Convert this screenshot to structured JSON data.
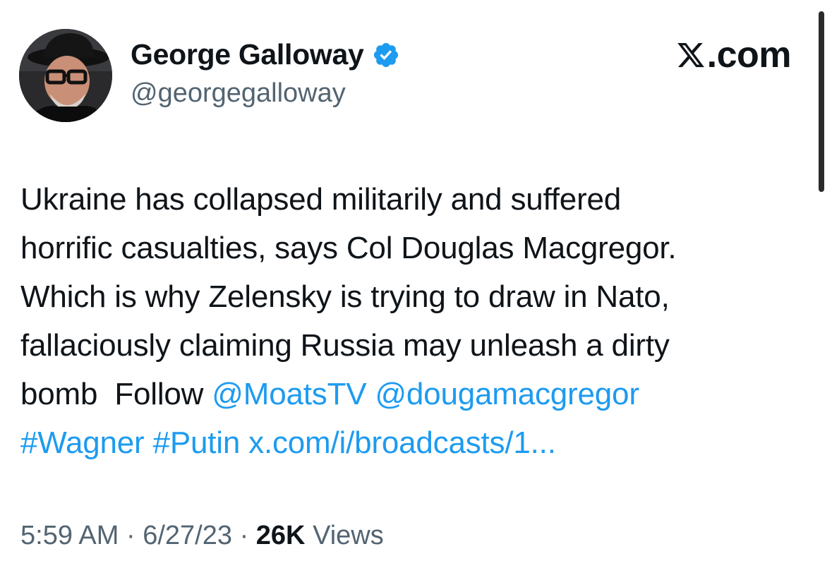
{
  "author": {
    "display_name": "George Galloway",
    "handle": "@georgegalloway",
    "verified_icon": "verified-badge-icon",
    "verified_color": "#1d9bf0"
  },
  "brand": {
    "icon": "x-logo-icon",
    "domain": ".com"
  },
  "tweet": {
    "line1": "Ukraine has collapsed militarily and suffered",
    "line2": "horrific casualties, says Col Douglas Macgregor.",
    "line3": "Which is why Zelensky is trying to draw in Nato,",
    "line4": "fallaciously claiming Russia may unleash a dirty",
    "line5_text": "bomb  Follow ",
    "mention1": "@MoatsTV",
    "mention2": "@dougamacgregor",
    "hashtag1": "#Wagner",
    "hashtag2": "#Putin",
    "link": "x.com/i/broadcasts/1..."
  },
  "meta": {
    "time": "5:59 AM",
    "separator": "·",
    "date": "6/27/23",
    "views_count": "26K",
    "views_label": "Views"
  },
  "colors": {
    "link": "#1d9bf0",
    "secondary_text": "#536471",
    "primary_text": "#0f1419"
  }
}
